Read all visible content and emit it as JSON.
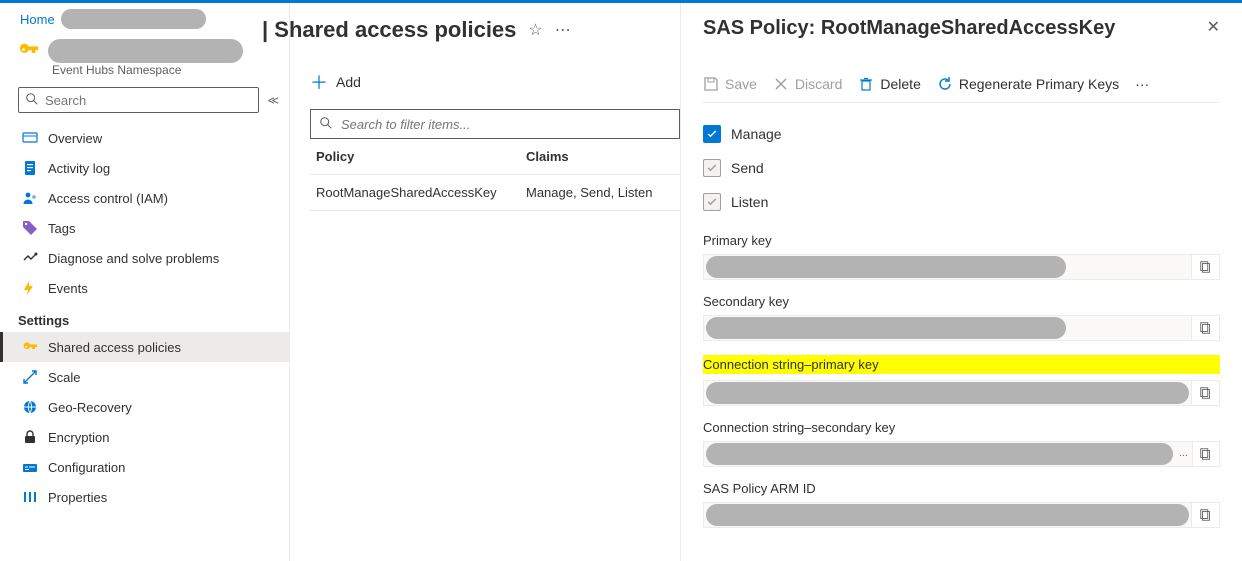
{
  "breadcrumb": {
    "home": "Home"
  },
  "header": {
    "page_title": "| Shared access policies",
    "subtitle": "Event Hubs Namespace"
  },
  "search": {
    "placeholder": "Search"
  },
  "nav": {
    "items": [
      {
        "label": "Overview"
      },
      {
        "label": "Activity log"
      },
      {
        "label": "Access control (IAM)"
      },
      {
        "label": "Tags"
      },
      {
        "label": "Diagnose and solve problems"
      },
      {
        "label": "Events"
      }
    ],
    "settings_label": "Settings",
    "settings_items": [
      {
        "label": "Shared access policies"
      },
      {
        "label": "Scale"
      },
      {
        "label": "Geo-Recovery"
      },
      {
        "label": "Encryption"
      },
      {
        "label": "Configuration"
      },
      {
        "label": "Properties"
      }
    ]
  },
  "toolbar": {
    "add": "Add"
  },
  "filter": {
    "placeholder": "Search to filter items..."
  },
  "table": {
    "col_policy": "Policy",
    "col_claims": "Claims",
    "rows": [
      {
        "policy": "RootManageSharedAccessKey",
        "claims": "Manage, Send, Listen"
      }
    ]
  },
  "panel": {
    "title": "SAS Policy: RootManageSharedAccessKey",
    "cmd_save": "Save",
    "cmd_discard": "Discard",
    "cmd_delete": "Delete",
    "cmd_regen": "Regenerate Primary Keys",
    "cmd_more": "···",
    "cb_manage": "Manage",
    "cb_send": "Send",
    "cb_listen": "Listen",
    "lbl_primary": "Primary key",
    "lbl_secondary": "Secondary key",
    "lbl_conn_primary": "Connection string–primary key",
    "lbl_conn_secondary": "Connection string–secondary key",
    "lbl_arm": "SAS Policy ARM ID"
  }
}
